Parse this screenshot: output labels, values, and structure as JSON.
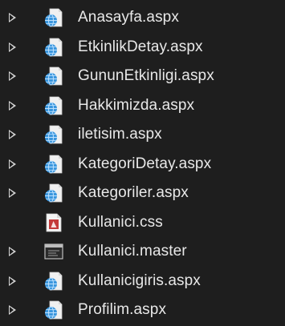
{
  "explorer": {
    "items": [
      {
        "label": "Anasayfa.aspx",
        "icon": "aspx-web-file-icon",
        "expandable": true
      },
      {
        "label": "EtkinlikDetay.aspx",
        "icon": "aspx-web-file-icon",
        "expandable": true
      },
      {
        "label": "GununEtkinligi.aspx",
        "icon": "aspx-web-file-icon",
        "expandable": true
      },
      {
        "label": "Hakkimizda.aspx",
        "icon": "aspx-web-file-icon",
        "expandable": true
      },
      {
        "label": "iletisim.aspx",
        "icon": "aspx-web-file-icon",
        "expandable": true
      },
      {
        "label": "KategoriDetay.aspx",
        "icon": "aspx-web-file-icon",
        "expandable": true
      },
      {
        "label": "Kategoriler.aspx",
        "icon": "aspx-web-file-icon",
        "expandable": true
      },
      {
        "label": "Kullanici.css",
        "icon": "css-file-icon",
        "expandable": false
      },
      {
        "label": "Kullanici.master",
        "icon": "master-page-icon",
        "expandable": true
      },
      {
        "label": "Kullanicigiris.aspx",
        "icon": "aspx-web-file-icon",
        "expandable": true
      },
      {
        "label": "Profilim.aspx",
        "icon": "aspx-web-file-icon",
        "expandable": true
      }
    ]
  },
  "colors": {
    "background": "#1e1e1e",
    "text": "#e8e8e8",
    "chevron": "#d4d4d4",
    "globe": "#3a96dd",
    "css_badge": "#c43a3a"
  }
}
